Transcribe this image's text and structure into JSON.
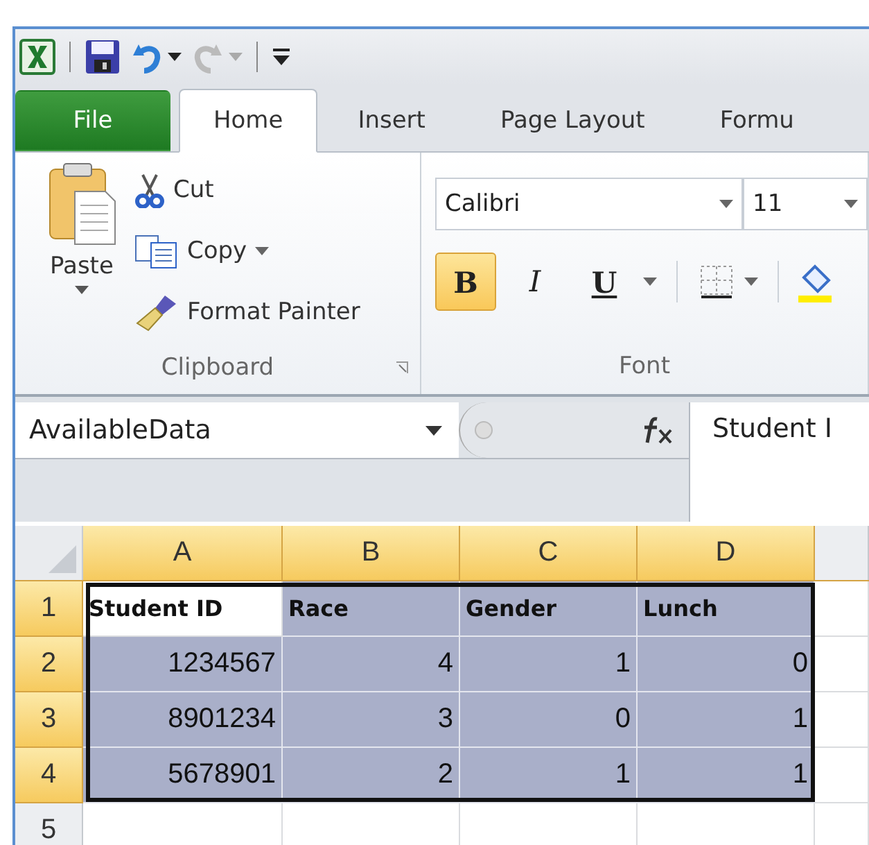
{
  "tabs": [
    {
      "label": "File",
      "kind": "file",
      "selected": false
    },
    {
      "label": "Home",
      "kind": "tab",
      "selected": true
    },
    {
      "label": "Insert",
      "kind": "tab",
      "selected": false
    },
    {
      "label": "Page Layout",
      "kind": "tab",
      "selected": false
    },
    {
      "label": "Formu",
      "kind": "tab",
      "selected": false
    }
  ],
  "clipboard": {
    "paste": "Paste",
    "cut": "Cut",
    "copy": "Copy",
    "format_painter": "Format Painter",
    "group_label": "Clipboard"
  },
  "font": {
    "name": "Calibri",
    "size": "11",
    "group_label": "Font",
    "buttons": [
      {
        "label": "B",
        "kind": "bold",
        "selected": true
      },
      {
        "label": "I",
        "kind": "italic",
        "selected": false
      },
      {
        "label": "U",
        "kind": "underline",
        "selected": false
      }
    ]
  },
  "formula_bar": {
    "name_box": "AvailableData",
    "value": "Student I"
  },
  "sheet": {
    "columns": [
      {
        "label": "A",
        "selected": true
      },
      {
        "label": "B",
        "selected": true
      },
      {
        "label": "C",
        "selected": true
      },
      {
        "label": "D",
        "selected": true
      }
    ],
    "rows": [
      {
        "label": "1",
        "selected": true,
        "cells": [
          {
            "value": "Student ID",
            "kind": "header",
            "selected": false
          },
          {
            "value": "Race",
            "kind": "header",
            "selected": true
          },
          {
            "value": "Gender",
            "kind": "header",
            "selected": true
          },
          {
            "value": "Lunch",
            "kind": "header",
            "selected": true
          }
        ]
      },
      {
        "label": "2",
        "selected": true,
        "cells": [
          {
            "value": "1234567",
            "kind": "number",
            "selected": true
          },
          {
            "value": "4",
            "kind": "number",
            "selected": true
          },
          {
            "value": "1",
            "kind": "number",
            "selected": true
          },
          {
            "value": "0",
            "kind": "number",
            "selected": true
          }
        ]
      },
      {
        "label": "3",
        "selected": true,
        "cells": [
          {
            "value": "8901234",
            "kind": "number",
            "selected": true
          },
          {
            "value": "3",
            "kind": "number",
            "selected": true
          },
          {
            "value": "0",
            "kind": "number",
            "selected": true
          },
          {
            "value": "1",
            "kind": "number",
            "selected": true
          }
        ]
      },
      {
        "label": "4",
        "selected": true,
        "cells": [
          {
            "value": "5678901",
            "kind": "number",
            "selected": true
          },
          {
            "value": "2",
            "kind": "number",
            "selected": true
          },
          {
            "value": "1",
            "kind": "number",
            "selected": true
          },
          {
            "value": "1",
            "kind": "number",
            "selected": true
          }
        ]
      },
      {
        "label": "5",
        "selected": false,
        "cells": []
      }
    ]
  }
}
